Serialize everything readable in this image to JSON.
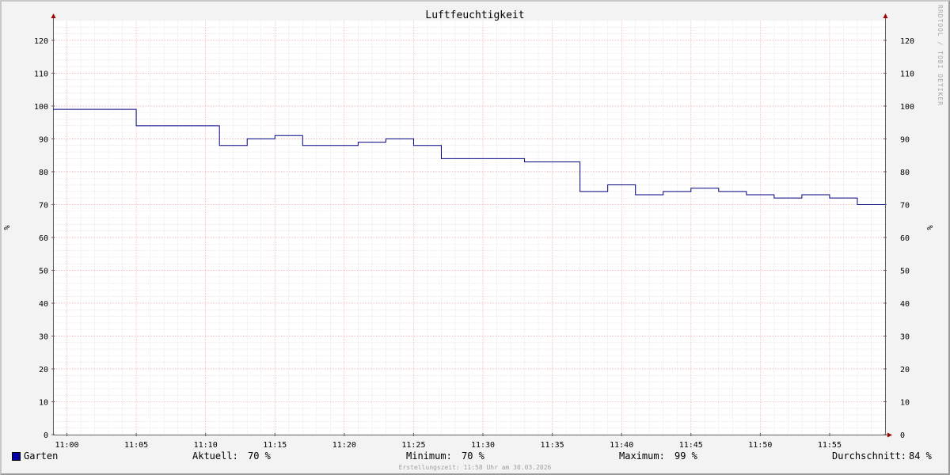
{
  "chart_data": {
    "type": "line",
    "title": "Luftfeuchtigkeit",
    "ylabel": "%",
    "ylim": [
      0,
      126
    ],
    "y_ticks": [
      0,
      10,
      20,
      30,
      40,
      50,
      60,
      70,
      80,
      90,
      100,
      110,
      120
    ],
    "x_tick_labels": [
      "11:00",
      "11:05",
      "11:10",
      "11:15",
      "11:20",
      "11:25",
      "11:30",
      "11:35",
      "11:40",
      "11:45",
      "11:50",
      "11:55"
    ],
    "x_range": [
      "10:59",
      "11:59"
    ],
    "grid": true,
    "series": [
      {
        "name": "Garten",
        "color": "#000080",
        "step": true,
        "x": [
          "10:59",
          "11:05",
          "11:11",
          "11:13",
          "11:15",
          "11:17",
          "11:21",
          "11:23",
          "11:25",
          "11:27",
          "11:33",
          "11:37",
          "11:39",
          "11:41",
          "11:43",
          "11:45",
          "11:47",
          "11:49",
          "11:51",
          "11:53",
          "11:55",
          "11:57"
        ],
        "values": [
          99,
          94,
          88,
          90,
          91,
          88,
          89,
          90,
          88,
          84,
          83,
          74,
          76,
          73,
          74,
          75,
          74,
          73,
          72,
          73,
          72,
          70
        ]
      }
    ]
  },
  "legend": {
    "series_name": "Garten",
    "series_color": "#0000a0",
    "current_label": "Aktuell:",
    "current_value": "70 %",
    "minimum_label": "Minimum:",
    "minimum_value": "70 %",
    "maximum_label": "Maximum:",
    "maximum_value": "99 %",
    "average_label": "Durchschnitt:",
    "average_value": "84 %"
  },
  "footer": "Erstellungszeit: 11:58 Uhr am 30.03.2026",
  "watermark": "RRDTOOL / TOBI OETIKER"
}
